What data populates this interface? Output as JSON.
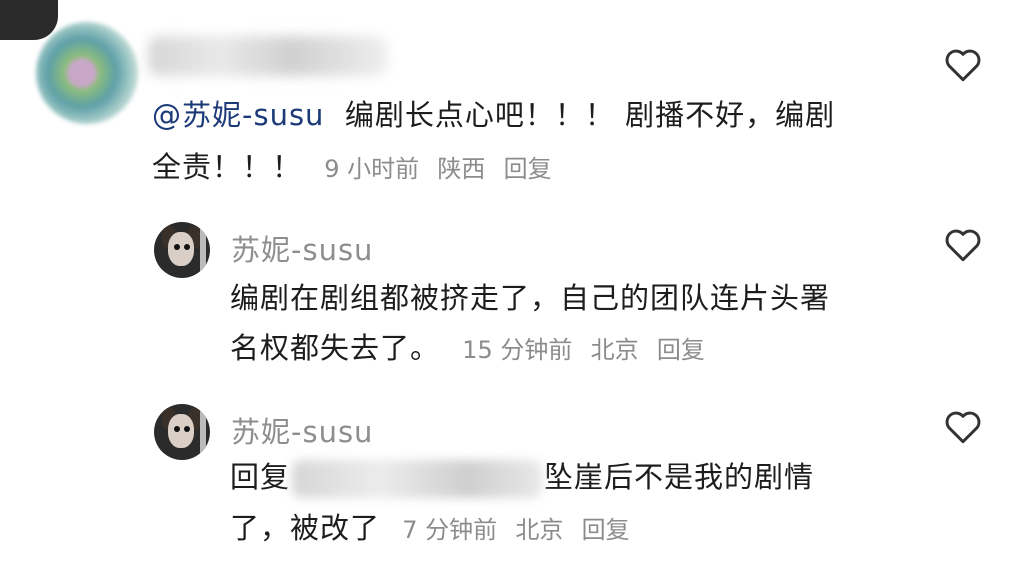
{
  "comment_main": {
    "mention": "@苏妮-susu",
    "text_line1": "编剧长点心吧！！！ 剧播不好，编剧",
    "text_line2": "全责！！！",
    "time": "9 小时前",
    "location": "陕西",
    "reply_label": "回复"
  },
  "replies": [
    {
      "author": "苏妮-susu",
      "text_line1": "编剧在剧组都被挤走了，自己的团队连片头署",
      "text_line2": "名权都失去了。",
      "time": "15 分钟前",
      "location": "北京",
      "reply_label": "回复"
    },
    {
      "author": "苏妮-susu",
      "prefix": "回复",
      "text_line1_after": "坠崖后不是我的剧情",
      "text_line2": "了，被改了",
      "time": "7 分钟前",
      "location": "北京",
      "reply_label": "回复"
    }
  ],
  "icons": {
    "like": "heart-outline-icon"
  },
  "colors": {
    "mention": "#1d3a78",
    "meta": "#8c8c8c",
    "author": "#8e8e8e"
  }
}
